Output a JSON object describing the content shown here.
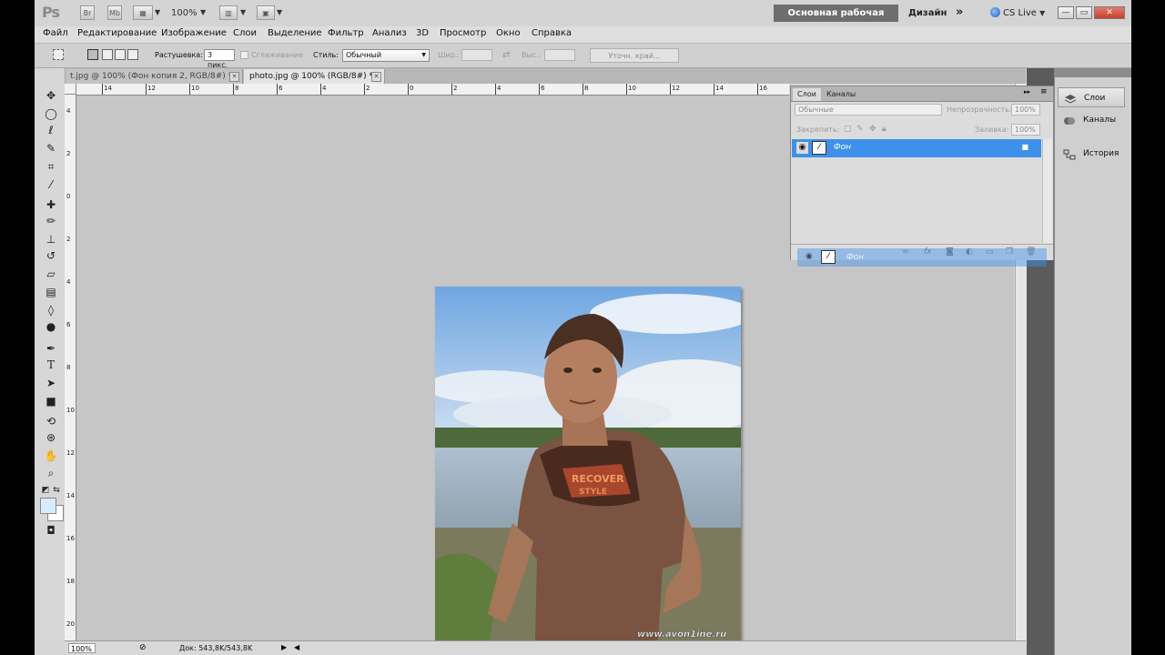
{
  "app": {
    "logo": "Ps",
    "bridge": "Br",
    "minibridge": "Mb",
    "zoom": "100%",
    "workspace_button": "Основная рабочая среда",
    "design": "Дизайн",
    "more": "»",
    "cslive": "CS Live",
    "win_min": "—",
    "win_max": "▭",
    "win_close": "✕"
  },
  "menu": [
    "Файл",
    "Редактирование",
    "Изображение",
    "Слои",
    "Выделение",
    "Фильтр",
    "Анализ",
    "3D",
    "Просмотр",
    "Окно",
    "Справка"
  ],
  "options": {
    "feather_label": "Растушевка:",
    "feather_value": "3 пикс.",
    "antialias": "Сглаживание",
    "style_label": "Стиль:",
    "style_value": "Обычный",
    "width_label": "Шир.:",
    "height_label": "Выс.:",
    "refine_edge": "Уточн. край..."
  },
  "tabs": [
    {
      "label": "t.jpg @ 100% (Фон копия 2, RGB/8#) *",
      "close": "✕"
    },
    {
      "label": "photo.jpg @ 100% (RGB/8#) *",
      "close": "✕"
    }
  ],
  "ruler_top": [
    "14",
    "12",
    "10",
    "8",
    "6",
    "4",
    "2",
    "0",
    "2",
    "4",
    "6",
    "8",
    "10",
    "12",
    "14",
    "16"
  ],
  "ruler_left": [
    "4",
    "2",
    "0",
    "2",
    "4",
    "6",
    "8",
    "10",
    "12",
    "14",
    "16",
    "18",
    "20"
  ],
  "status": {
    "zoom": "100%",
    "doc": "Док: 543,8K/543,8K"
  },
  "photo": {
    "watermark": "www.avon1ine.ru"
  },
  "layers_panel": {
    "tab_layers": "Слои",
    "tab_channels": "Каналы",
    "blend_mode": "Обычные",
    "opacity_label": "Непрозрачность:",
    "opacity_value": "100%",
    "lock_label": "Закрепить:",
    "fill_label": "Заливка:",
    "fill_value": "100%",
    "layer_name": "Фон",
    "ghost_layer_name": "Фон"
  },
  "dock": {
    "layers": "Слои",
    "channels": "Каналы",
    "history": "История"
  }
}
